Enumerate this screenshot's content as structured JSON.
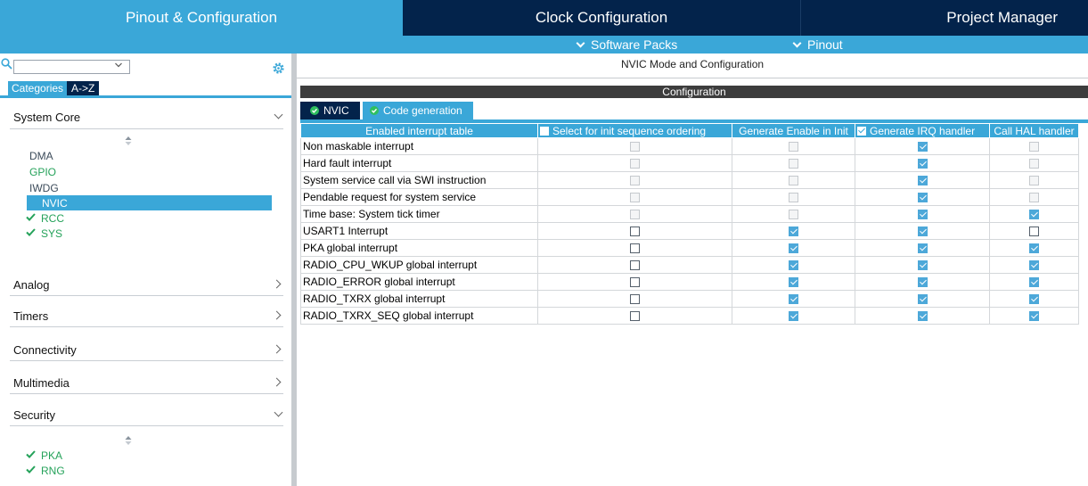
{
  "top_tabs": {
    "pinout": "Pinout & Configuration",
    "clock": "Clock Configuration",
    "project": "Project Manager"
  },
  "sub_bar": {
    "software_packs": "Software Packs",
    "pinout": "Pinout"
  },
  "left": {
    "search_value": "",
    "tab_categories": "Categories",
    "tab_az": "A->Z",
    "sections": {
      "system_core": "System Core",
      "analog": "Analog",
      "timers": "Timers",
      "connectivity": "Connectivity",
      "multimedia": "Multimedia",
      "security": "Security"
    },
    "system_core_items": [
      {
        "label": "DMA",
        "state": "normal"
      },
      {
        "label": "GPIO",
        "state": "green"
      },
      {
        "label": "IWDG",
        "state": "normal"
      },
      {
        "label": "NVIC",
        "state": "selected"
      },
      {
        "label": "RCC",
        "state": "checked"
      },
      {
        "label": "SYS",
        "state": "checked"
      }
    ],
    "security_items": [
      {
        "label": "PKA",
        "state": "checked"
      },
      {
        "label": "RNG",
        "state": "checked"
      }
    ]
  },
  "right": {
    "title": "NVIC Mode and Configuration",
    "config_header": "Configuration",
    "tab_nvic": "NVIC",
    "tab_codegen": "Code generation",
    "columns": {
      "table": "Enabled interrupt table",
      "init_seq": "Select for init sequence ordering",
      "gen_enable": "Generate Enable in Init",
      "gen_irq": "Generate IRQ handler",
      "call_hal": "Call HAL handler"
    },
    "header_checkbox_init_seq": false,
    "header_checkbox_gen_irq": true,
    "rows": [
      {
        "name": "Non maskable interrupt",
        "init_seq": "disabled",
        "gen_enable": "disabled",
        "gen_irq": "checked",
        "call_hal": "disabled"
      },
      {
        "name": "Hard fault interrupt",
        "init_seq": "disabled",
        "gen_enable": "disabled",
        "gen_irq": "checked",
        "call_hal": "disabled"
      },
      {
        "name": "System service call via SWI instruction",
        "init_seq": "disabled",
        "gen_enable": "disabled",
        "gen_irq": "checked",
        "call_hal": "disabled"
      },
      {
        "name": "Pendable request for system service",
        "init_seq": "disabled",
        "gen_enable": "disabled",
        "gen_irq": "checked",
        "call_hal": "disabled"
      },
      {
        "name": "Time base: System tick timer",
        "init_seq": "disabled",
        "gen_enable": "disabled",
        "gen_irq": "checked",
        "call_hal": "checked"
      },
      {
        "name": "USART1 Interrupt",
        "init_seq": "unchecked",
        "gen_enable": "checked",
        "gen_irq": "checked",
        "call_hal": "unchecked"
      },
      {
        "name": "PKA global interrupt",
        "init_seq": "unchecked",
        "gen_enable": "checked",
        "gen_irq": "checked",
        "call_hal": "checked"
      },
      {
        "name": "RADIO_CPU_WKUP global interrupt",
        "init_seq": "unchecked",
        "gen_enable": "checked",
        "gen_irq": "checked",
        "call_hal": "checked"
      },
      {
        "name": "RADIO_ERROR global interrupt",
        "init_seq": "unchecked",
        "gen_enable": "checked",
        "gen_irq": "checked",
        "call_hal": "checked"
      },
      {
        "name": "RADIO_TXRX global interrupt",
        "init_seq": "unchecked",
        "gen_enable": "checked",
        "gen_irq": "checked",
        "call_hal": "checked"
      },
      {
        "name": "RADIO_TXRX_SEQ global interrupt",
        "init_seq": "unchecked",
        "gen_enable": "checked",
        "gen_irq": "checked",
        "call_hal": "checked"
      }
    ]
  },
  "colors": {
    "accent": "#3aa7d8",
    "navy": "#03234b",
    "green": "#25a25a",
    "check_blue": "#4da8d9"
  },
  "icons": {
    "search": "search-icon",
    "gear": "gear-icon",
    "sort": "sort-icon",
    "check": "check-icon",
    "chevron": "chevron-down-icon"
  }
}
